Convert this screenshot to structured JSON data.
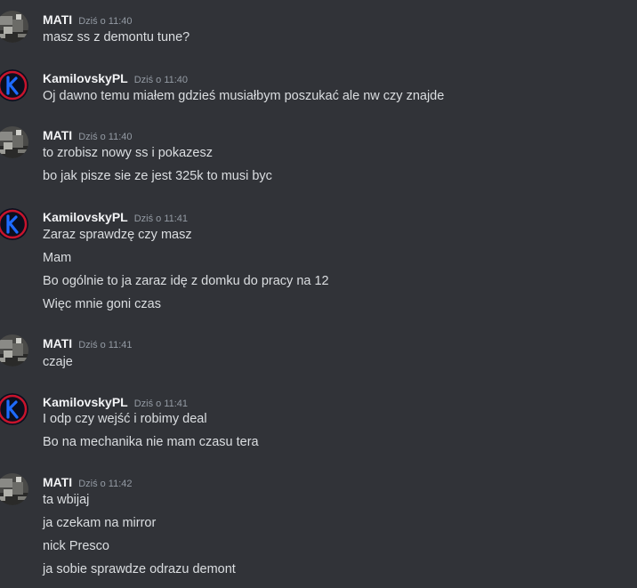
{
  "messages": [
    {
      "author": "MATI",
      "avatar_icon": "mati-avatar-icon",
      "time": "Dziś o 11:40",
      "lines": [
        "masz ss z demontu tune?"
      ]
    },
    {
      "author": "KamilovskyPL",
      "avatar_icon": "kamilovsky-k-avatar-icon",
      "time": "Dziś o 11:40",
      "lines": [
        "Oj dawno temu miałem gdzieś musiałbym poszukać ale nw czy znajde"
      ]
    },
    {
      "author": "MATI",
      "avatar_icon": "mati-avatar-icon",
      "time": "Dziś o 11:40",
      "lines": [
        "to zrobisz nowy ss i pokazesz",
        "bo jak pisze sie ze jest 325k to musi byc"
      ]
    },
    {
      "author": "KamilovskyPL",
      "avatar_icon": "kamilovsky-k-avatar-icon",
      "time": "Dziś o 11:41",
      "lines": [
        "Zaraz sprawdzę czy masz",
        "Mam",
        "Bo ogólnie to ja zaraz idę z domku do pracy na 12",
        "Więc mnie goni czas"
      ]
    },
    {
      "author": "MATI",
      "avatar_icon": "mati-avatar-icon",
      "time": "Dziś o 11:41",
      "lines": [
        "czaje"
      ]
    },
    {
      "author": "KamilovskyPL",
      "avatar_icon": "kamilovsky-k-avatar-icon",
      "time": "Dziś o 11:41",
      "lines": [
        "I odp czy wejść i robimy deal",
        "Bo na mechanika nie mam czasu tera"
      ]
    },
    {
      "author": "MATI",
      "avatar_icon": "mati-avatar-icon",
      "time": "Dziś o 11:42",
      "lines": [
        "ta wbijaj",
        "ja czekam na mirror",
        "nick Presco",
        "ja sobie sprawdze odrazu demont"
      ]
    }
  ],
  "colors": {
    "background": "#313338",
    "username": "#f2f3f5",
    "message_text": "#dbdee1",
    "timestamp": "#949ba4",
    "kamilovsky_avatar_accent": "#1e6bff"
  }
}
